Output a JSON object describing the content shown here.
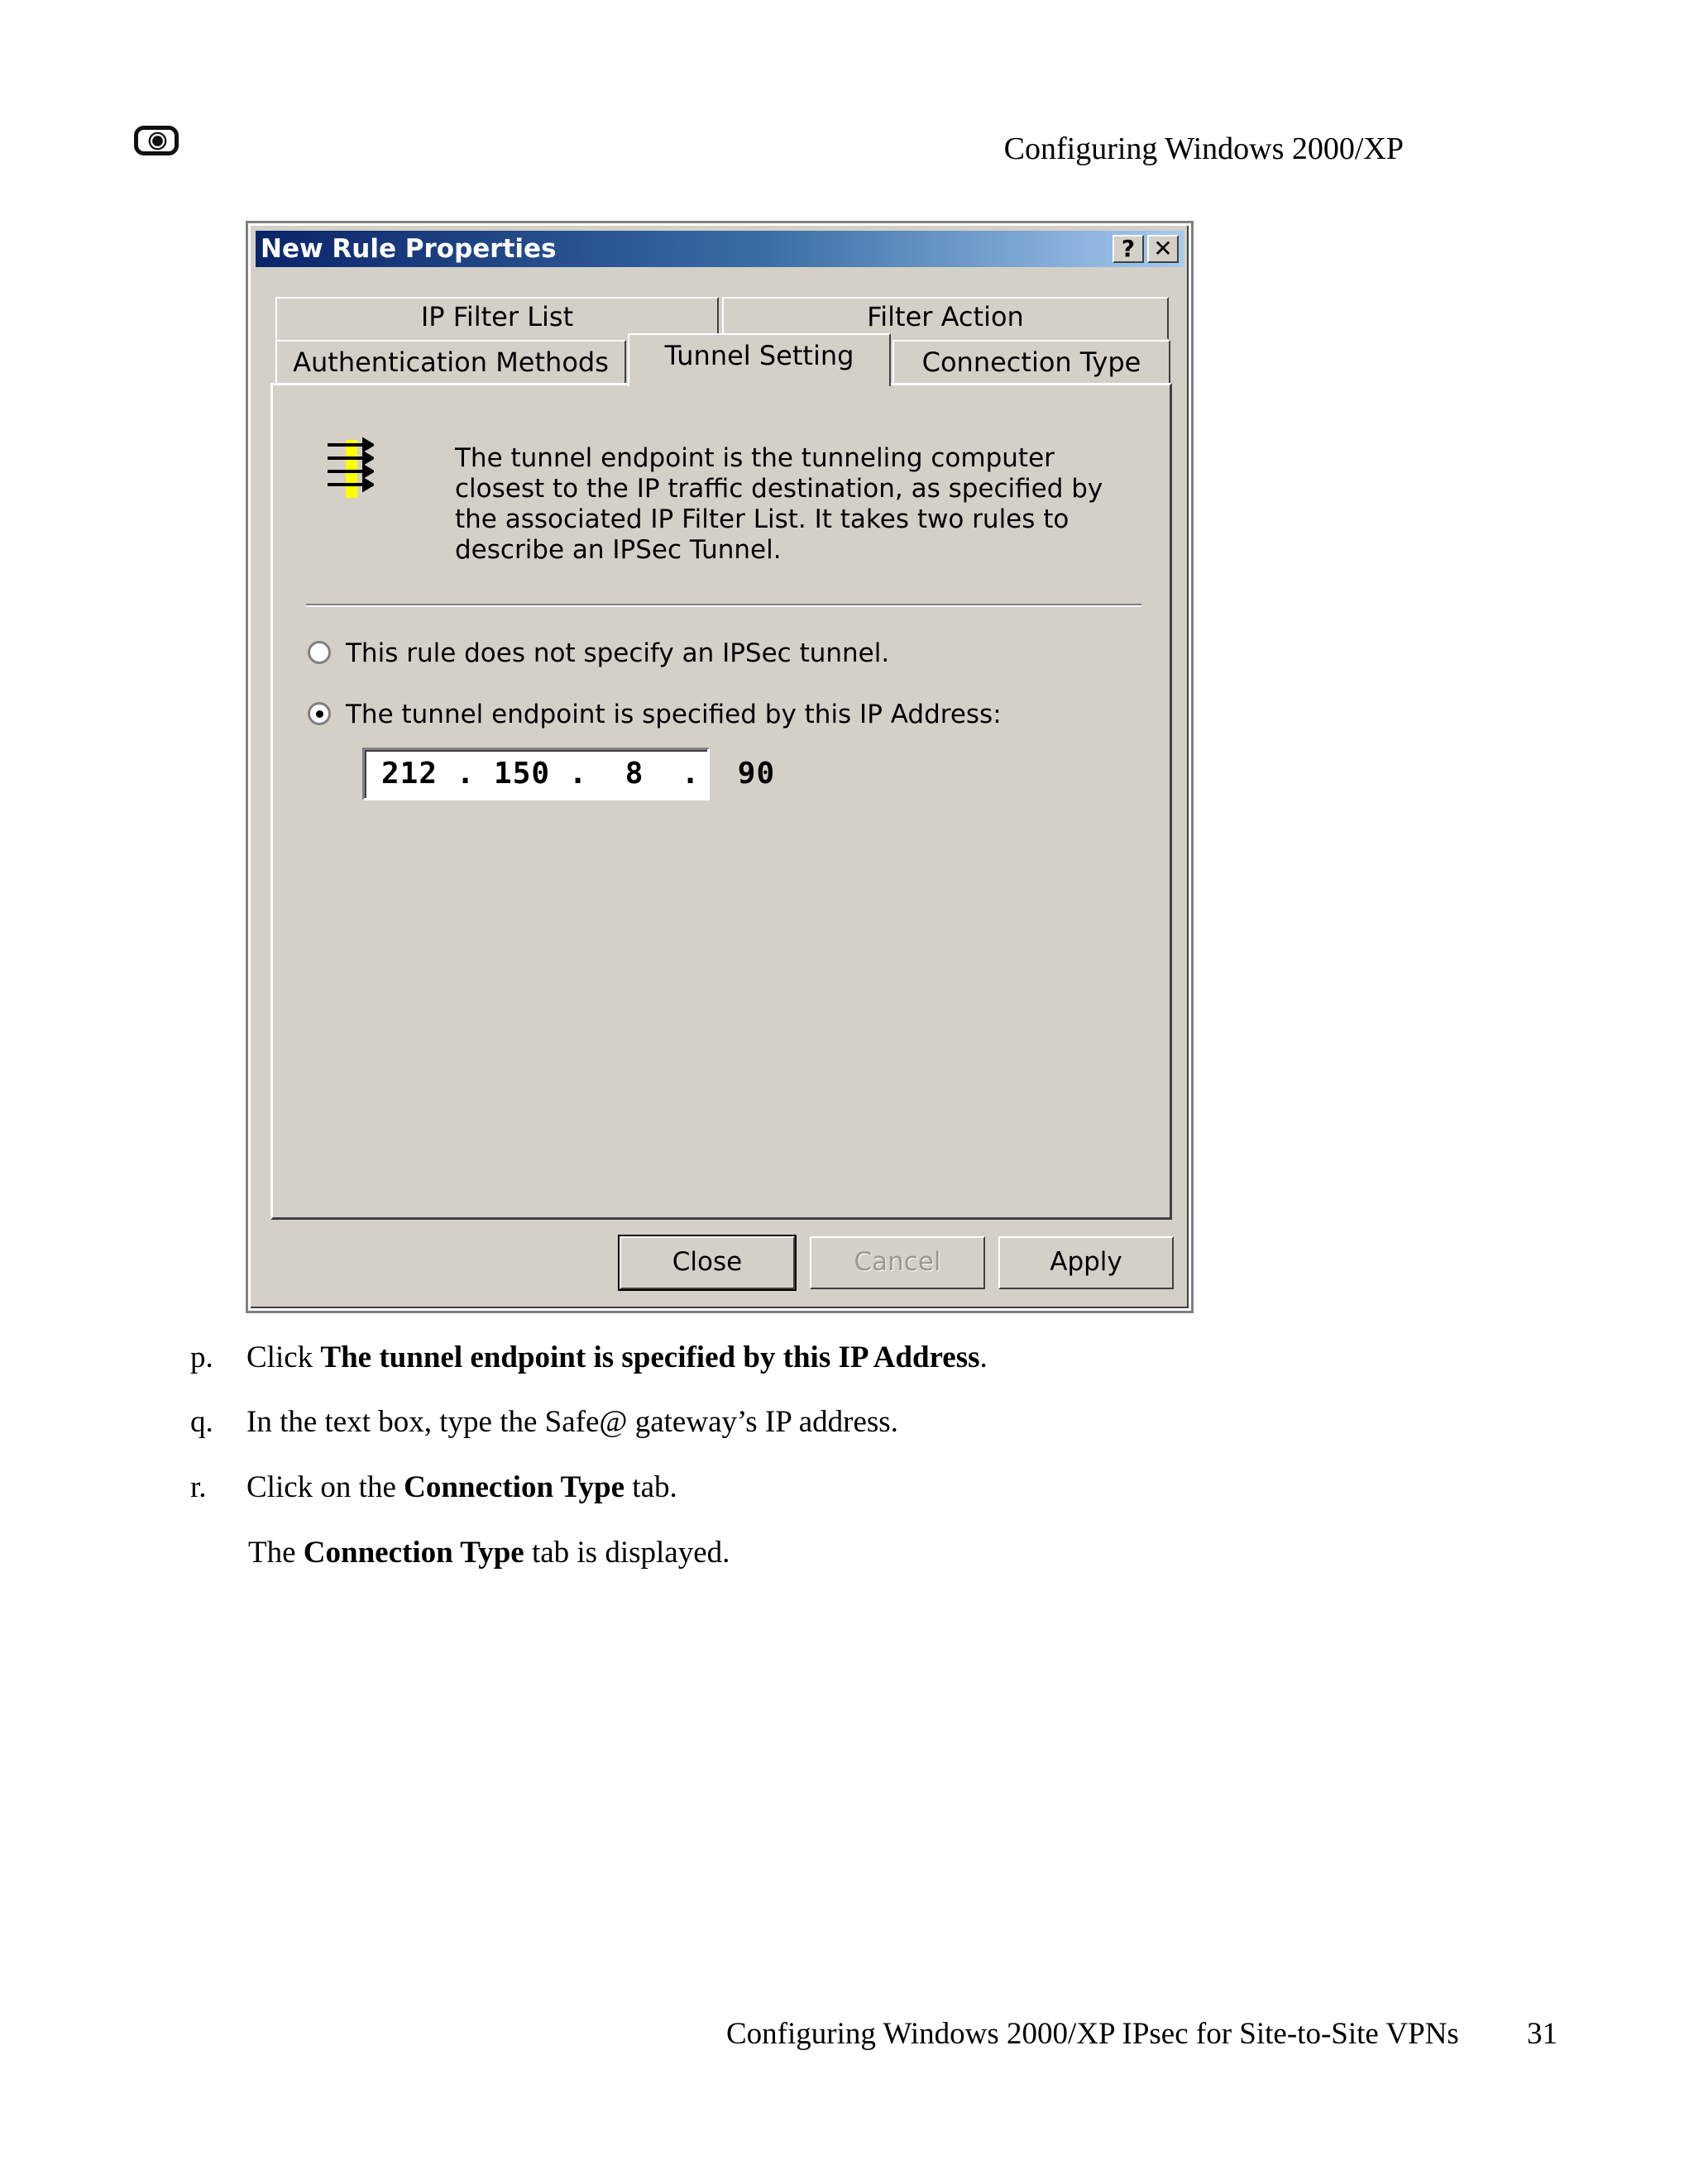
{
  "header": {
    "running_head": "Configuring Windows 2000/XP"
  },
  "dialog": {
    "title": "New Rule Properties",
    "help_glyph": "?",
    "close_glyph": "✕",
    "tabs": {
      "ip_filter_list": "IP Filter List",
      "filter_action": "Filter Action",
      "authentication_methods": "Authentication Methods",
      "tunnel_setting": "Tunnel Setting",
      "connection_type": "Connection Type"
    },
    "active_tab": "Tunnel Setting",
    "description": "The tunnel endpoint is the tunneling computer closest to the IP traffic destination, as specified by the associated IP Filter List. It takes two rules to describe an IPSec Tunnel.",
    "radio_no_tunnel": "This rule does not specify an IPSec tunnel.",
    "radio_ip_endpoint": "The tunnel endpoint is specified by this IP Address:",
    "ip_address": "212 . 150 .  8  .  90",
    "buttons": {
      "close": "Close",
      "cancel": "Cancel",
      "apply": "Apply"
    }
  },
  "steps": [
    {
      "label": "p.",
      "pre": "Click ",
      "bold": "The tunnel endpoint is specified by this IP Address",
      "post": "."
    },
    {
      "label": "q.",
      "text": "In the text box, type the Safe@ gateway’s IP address."
    },
    {
      "label": "r.",
      "pre": "Click on the ",
      "bold": "Connection Type",
      "post": " tab."
    }
  ],
  "note": {
    "pre": "The ",
    "bold": "Connection Type",
    "post": " tab is displayed."
  },
  "footer": {
    "title": "Configuring Windows 2000/XP IPsec for Site-to-Site VPNs",
    "page": "31"
  }
}
